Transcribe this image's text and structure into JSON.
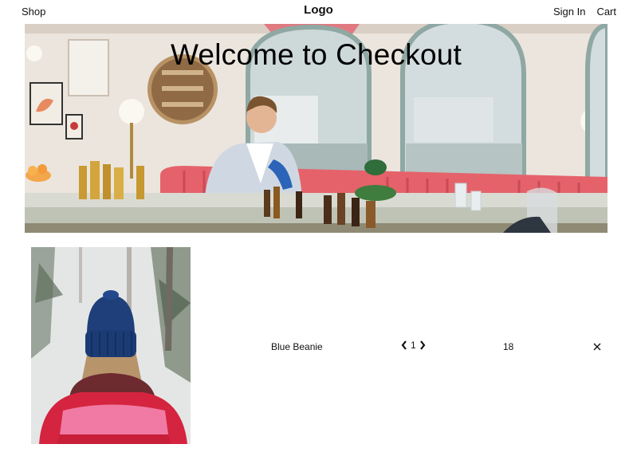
{
  "header": {
    "shop_label": "Shop",
    "logo_label": "Logo",
    "sign_in_label": "Sign In",
    "cart_label": "Cart"
  },
  "hero": {
    "title": "Welcome to Checkout",
    "image": "restaurant-bar-photo"
  },
  "cart": {
    "items": [
      {
        "image": "blue-beanie-photo",
        "name": "Blue Beanie",
        "quantity": "1",
        "price": "18"
      }
    ],
    "decrement_icon": "chevron-left-icon",
    "increment_icon": "chevron-right-icon",
    "remove_icon": "close-icon"
  },
  "colors": {
    "text": "#111111",
    "background": "#ffffff",
    "booth_pink": "#e5626b",
    "beanie_blue": "#1f3f7a",
    "jacket_red": "#d4243f"
  }
}
